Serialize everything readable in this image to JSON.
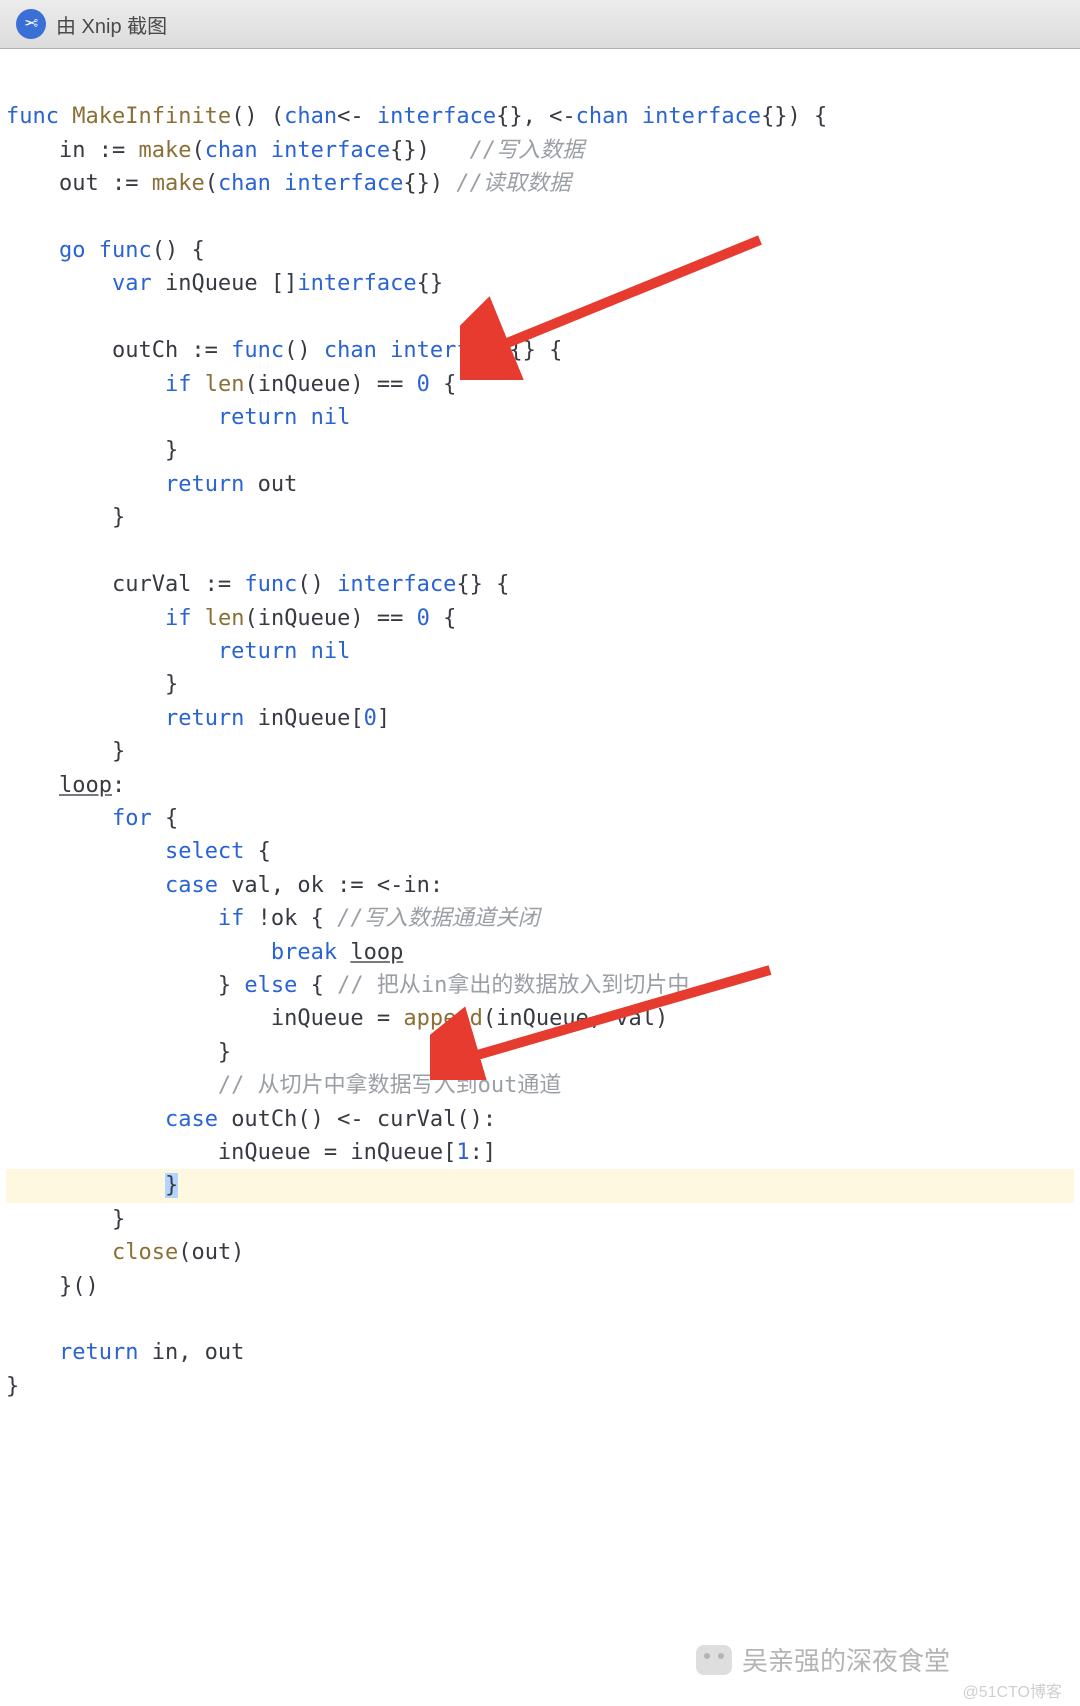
{
  "titlebar": {
    "text": "由 Xnip 截图"
  },
  "code": {
    "l1": {
      "a": "func ",
      "b": "MakeInfinite",
      "c": "() (",
      "d": "chan",
      "e": "<- ",
      "f": "interface",
      "g": "{}, <-",
      "h": "chan ",
      "i": "interface",
      "j": "{}) {"
    },
    "l2": {
      "a": "    in := ",
      "b": "make",
      "c": "(",
      "d": "chan ",
      "e": "interface",
      "f": "{})   ",
      "g": "//写入数据"
    },
    "l3": {
      "a": "    out := ",
      "b": "make",
      "c": "(",
      "d": "chan ",
      "e": "interface",
      "f": "{}) ",
      "g": "//读取数据"
    },
    "l4": "",
    "l5": {
      "a": "    ",
      "b": "go func",
      "c": "() {"
    },
    "l6": {
      "a": "        ",
      "b": "var ",
      "c": "inQueue []",
      "d": "interface",
      "e": "{}"
    },
    "l7": "",
    "l8": {
      "a": "        outCh := ",
      "b": "func",
      "c": "() ",
      "d": "chan ",
      "e": "interface",
      "f": "{} {"
    },
    "l9": {
      "a": "            ",
      "b": "if ",
      "c": "len",
      "d": "(inQueue) == ",
      "e": "0",
      "f": " {"
    },
    "l10": {
      "a": "                ",
      "b": "return nil"
    },
    "l11": "            }",
    "l12": {
      "a": "            ",
      "b": "return ",
      "c": "out"
    },
    "l13": "        }",
    "l14": "",
    "l15": {
      "a": "        curVal := ",
      "b": "func",
      "c": "() ",
      "d": "interface",
      "e": "{} {"
    },
    "l16": {
      "a": "            ",
      "b": "if ",
      "c": "len",
      "d": "(inQueue) == ",
      "e": "0",
      "f": " {"
    },
    "l17": {
      "a": "                ",
      "b": "return nil"
    },
    "l18": "            }",
    "l19": {
      "a": "            ",
      "b": "return ",
      "c": "inQueue[",
      "d": "0",
      "e": "]"
    },
    "l20": "        }",
    "l21": {
      "a": "    ",
      "b": "loop",
      "c": ":"
    },
    "l22": {
      "a": "        ",
      "b": "for ",
      "c": "{"
    },
    "l23": {
      "a": "            ",
      "b": "select ",
      "c": "{"
    },
    "l24": {
      "a": "            ",
      "b": "case ",
      "c": "val, ok := <-in:"
    },
    "l25": {
      "a": "                ",
      "b": "if ",
      "c": "!ok { ",
      "d": "//写入数据通道关闭"
    },
    "l26": {
      "a": "                    ",
      "b": "break ",
      "c": "loop"
    },
    "l27": {
      "a": "                } ",
      "b": "else ",
      "c": "{ ",
      "d": "// 把从in拿出的数据放入到切片中"
    },
    "l28": {
      "a": "                    inQueue = ",
      "b": "append",
      "c": "(inQueue, val)"
    },
    "l29": "                }",
    "l30": {
      "a": "                ",
      "b": "// 从切片中拿数据写入到out通道"
    },
    "l31": {
      "a": "            ",
      "b": "case ",
      "c": "outCh() <- curVal():"
    },
    "l32": {
      "a": "                inQueue = inQueue[",
      "b": "1",
      "c": ":]"
    },
    "l33": {
      "a": "            ",
      "b": "}"
    },
    "l34": "        }",
    "l35": {
      "a": "        ",
      "b": "close",
      "c": "(out)"
    },
    "l36": "    }()",
    "l37": "",
    "l38": {
      "a": "    ",
      "b": "return ",
      "c": "in, out"
    },
    "l39": "}"
  },
  "watermark1": "吴亲强的深夜食堂",
  "watermark2": "@51CTO博客"
}
